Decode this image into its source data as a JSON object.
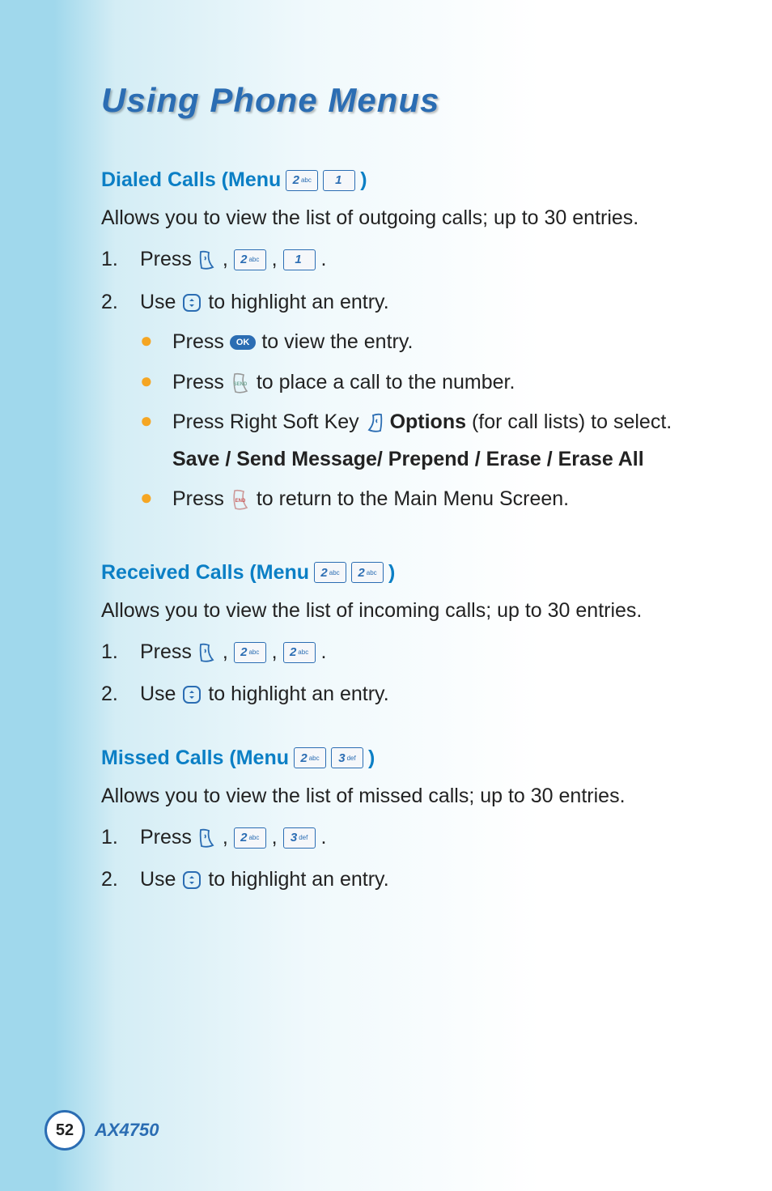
{
  "page": {
    "title": "Using Phone Menus",
    "number": "52",
    "model": "AX4750"
  },
  "keys": {
    "k1": {
      "digit": "1",
      "sub": ""
    },
    "k2": {
      "digit": "2",
      "sub": "abc"
    },
    "k3": {
      "digit": "3",
      "sub": "def"
    },
    "ok": "OK"
  },
  "sections": {
    "dialed": {
      "title_prefix": "Dialed Calls (Menu ",
      "title_suffix": ")",
      "desc": "Allows you to view the list of outgoing calls; up to 30 entries.",
      "step1_a": "Press ",
      "step1_comma": " , ",
      "step1_end": " .",
      "step2_a": "Use ",
      "step2_b": " to highlight an entry.",
      "b1_a": "Press ",
      "b1_b": " to view the entry.",
      "b2_a": "Press ",
      "b2_b": " to place a call to the number.",
      "b3_a": "Press Right Soft Key ",
      "b3_b_bold": "Options",
      "b3_c": " (for call lists) to select.",
      "b3_d_bold": "Save / Send Message/ Prepend / Erase / Erase All",
      "b4_a": "Press ",
      "b4_b": " to return to the Main Menu Screen."
    },
    "received": {
      "title_prefix": "Received Calls (Menu ",
      "title_suffix": ")",
      "desc": "Allows you to view the list of incoming calls; up to 30 entries.",
      "step1_a": "Press ",
      "step1_comma": " , ",
      "step1_end": " .",
      "step2_a": "Use ",
      "step2_b": " to highlight an entry."
    },
    "missed": {
      "title_prefix": "Missed Calls (Menu ",
      "title_suffix": ")",
      "desc": "Allows you to view the list of missed calls; up to 30 entries.",
      "step1_a": "Press ",
      "step1_comma": " , ",
      "step1_end": " .",
      "step2_a": "Use ",
      "step2_b": " to highlight an entry."
    }
  },
  "nums": {
    "one": "1.",
    "two": "2."
  }
}
